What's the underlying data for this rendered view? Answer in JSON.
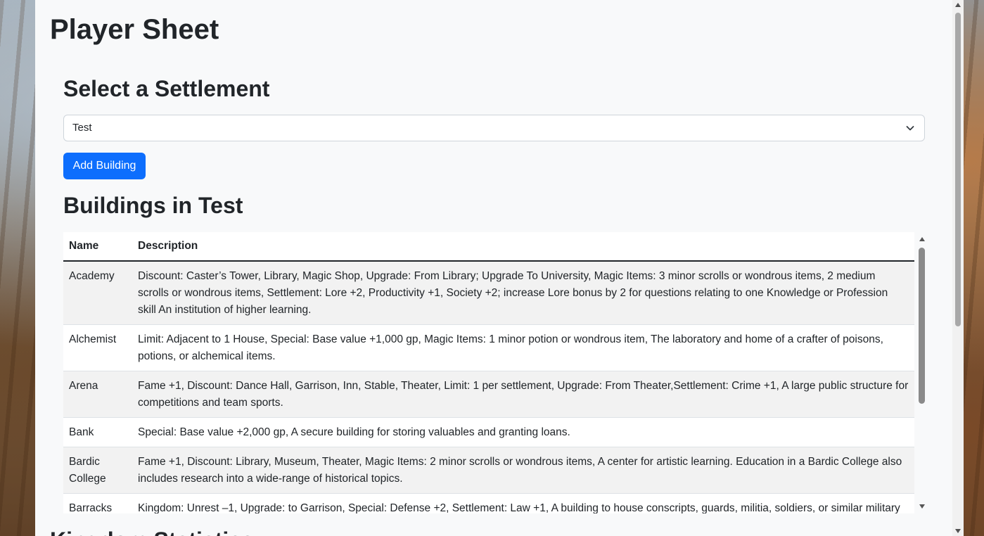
{
  "page": {
    "title": "Player Sheet",
    "next_section_partial": "Kingdom Statistics"
  },
  "settlement": {
    "heading": "Select a Settlement",
    "selected": "Test",
    "chevron_icon": "chevron-down-icon"
  },
  "actions": {
    "add_building_label": "Add Building"
  },
  "buildings": {
    "heading": "Buildings in Test",
    "columns": [
      "Name",
      "Description"
    ],
    "rows": [
      {
        "name": "Academy",
        "description": "Discount: Caster’s Tower, Library, Magic Shop, Upgrade: From Library; Upgrade To University, Magic Items: 3 minor scrolls or wondrous items, 2 medium scrolls or wondrous items, Settlement: Lore +2, Productivity +1, Society +2; increase Lore bonus by 2 for questions relating to one Knowledge or Profession skill An institution of higher learning."
      },
      {
        "name": "Alchemist",
        "description": "Limit: Adjacent to 1 House, Special: Base value +1,000 gp, Magic Items: 1 minor potion or wondrous item, The laboratory and home of a crafter of poisons, potions, or alchemical items."
      },
      {
        "name": "Arena",
        "description": "Fame +1, Discount: Dance Hall, Garrison, Inn, Stable, Theater, Limit: 1 per settlement, Upgrade: From Theater,Settlement: Crime +1, A large public structure for competitions and team sports."
      },
      {
        "name": "Bank",
        "description": "Special: Base value +2,000 gp, A secure building for storing valuables and granting loans."
      },
      {
        "name": "Bardic College",
        "description": "Fame +1, Discount: Library, Museum, Theater, Magic Items: 2 minor scrolls or wondrous items, A center for artistic learning. Education in a Bardic College also includes research into a wide-range of historical topics."
      },
      {
        "name": "Barracks",
        "description": "Kingdom: Unrest –1, Upgrade: to Garrison, Special: Defense +2, Settlement: Law +1, A building to house conscripts, guards, militia, soldiers, or similar military forces."
      }
    ]
  }
}
